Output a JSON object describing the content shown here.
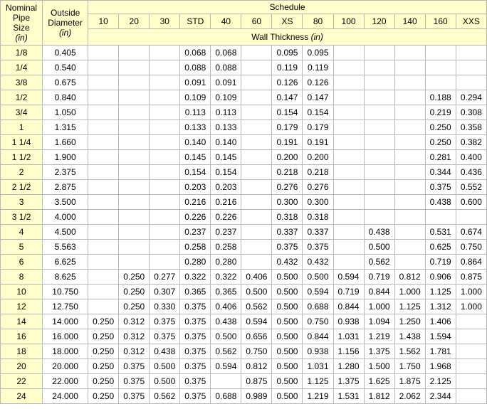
{
  "header": {
    "nominal_lines": [
      "Nominal",
      "Pipe",
      "Size"
    ],
    "nominal_unit": "(in)",
    "outside_lines": [
      "Outside",
      "Diameter"
    ],
    "outside_unit": "(in)",
    "schedule_title": "Schedule",
    "wall_label": "Wall Thickness",
    "wall_unit": "(in)"
  },
  "schedules": [
    "10",
    "20",
    "30",
    "STD",
    "40",
    "60",
    "XS",
    "80",
    "100",
    "120",
    "140",
    "160",
    "XXS"
  ],
  "rows": [
    {
      "nps": "1/8",
      "od": "0.405",
      "t": [
        "",
        "",
        "",
        "0.068",
        "0.068",
        "",
        "0.095",
        "0.095",
        "",
        "",
        "",
        "",
        ""
      ]
    },
    {
      "nps": "1/4",
      "od": "0.540",
      "t": [
        "",
        "",
        "",
        "0.088",
        "0.088",
        "",
        "0.119",
        "0.119",
        "",
        "",
        "",
        "",
        ""
      ]
    },
    {
      "nps": "3/8",
      "od": "0.675",
      "t": [
        "",
        "",
        "",
        "0.091",
        "0.091",
        "",
        "0.126",
        "0.126",
        "",
        "",
        "",
        "",
        ""
      ]
    },
    {
      "nps": "1/2",
      "od": "0.840",
      "t": [
        "",
        "",
        "",
        "0.109",
        "0.109",
        "",
        "0.147",
        "0.147",
        "",
        "",
        "",
        "0.188",
        "0.294"
      ]
    },
    {
      "nps": "3/4",
      "od": "1.050",
      "t": [
        "",
        "",
        "",
        "0.113",
        "0.113",
        "",
        "0.154",
        "0.154",
        "",
        "",
        "",
        "0.219",
        "0.308"
      ]
    },
    {
      "nps": "1",
      "od": "1.315",
      "t": [
        "",
        "",
        "",
        "0.133",
        "0.133",
        "",
        "0.179",
        "0.179",
        "",
        "",
        "",
        "0.250",
        "0.358"
      ]
    },
    {
      "nps": "1 1/4",
      "od": "1.660",
      "t": [
        "",
        "",
        "",
        "0.140",
        "0.140",
        "",
        "0.191",
        "0.191",
        "",
        "",
        "",
        "0.250",
        "0.382"
      ]
    },
    {
      "nps": "1 1/2",
      "od": "1.900",
      "t": [
        "",
        "",
        "",
        "0.145",
        "0.145",
        "",
        "0.200",
        "0.200",
        "",
        "",
        "",
        "0.281",
        "0.400"
      ]
    },
    {
      "nps": "2",
      "od": "2.375",
      "t": [
        "",
        "",
        "",
        "0.154",
        "0.154",
        "",
        "0.218",
        "0.218",
        "",
        "",
        "",
        "0.344",
        "0.436"
      ]
    },
    {
      "nps": "2 1/2",
      "od": "2.875",
      "t": [
        "",
        "",
        "",
        "0.203",
        "0.203",
        "",
        "0.276",
        "0.276",
        "",
        "",
        "",
        "0.375",
        "0.552"
      ]
    },
    {
      "nps": "3",
      "od": "3.500",
      "t": [
        "",
        "",
        "",
        "0.216",
        "0.216",
        "",
        "0.300",
        "0.300",
        "",
        "",
        "",
        "0.438",
        "0.600"
      ]
    },
    {
      "nps": "3 1/2",
      "od": "4.000",
      "t": [
        "",
        "",
        "",
        "0.226",
        "0.226",
        "",
        "0.318",
        "0.318",
        "",
        "",
        "",
        "",
        ""
      ]
    },
    {
      "nps": "4",
      "od": "4.500",
      "t": [
        "",
        "",
        "",
        "0.237",
        "0.237",
        "",
        "0.337",
        "0.337",
        "",
        "0.438",
        "",
        "0.531",
        "0.674"
      ]
    },
    {
      "nps": "5",
      "od": "5.563",
      "t": [
        "",
        "",
        "",
        "0.258",
        "0.258",
        "",
        "0.375",
        "0.375",
        "",
        "0.500",
        "",
        "0.625",
        "0.750"
      ]
    },
    {
      "nps": "6",
      "od": "6.625",
      "t": [
        "",
        "",
        "",
        "0.280",
        "0.280",
        "",
        "0.432",
        "0.432",
        "",
        "0.562",
        "",
        "0.719",
        "0.864"
      ]
    },
    {
      "nps": "8",
      "od": "8.625",
      "t": [
        "",
        "0.250",
        "0.277",
        "0.322",
        "0.322",
        "0.406",
        "0.500",
        "0.500",
        "0.594",
        "0.719",
        "0.812",
        "0.906",
        "0.875"
      ]
    },
    {
      "nps": "10",
      "od": "10.750",
      "t": [
        "",
        "0.250",
        "0.307",
        "0.365",
        "0.365",
        "0.500",
        "0.500",
        "0.594",
        "0.719",
        "0.844",
        "1.000",
        "1.125",
        "1.000"
      ]
    },
    {
      "nps": "12",
      "od": "12.750",
      "t": [
        "",
        "0.250",
        "0.330",
        "0.375",
        "0.406",
        "0.562",
        "0.500",
        "0.688",
        "0.844",
        "1.000",
        "1.125",
        "1.312",
        "1.000"
      ]
    },
    {
      "nps": "14",
      "od": "14.000",
      "t": [
        "0.250",
        "0.312",
        "0.375",
        "0.375",
        "0.438",
        "0.594",
        "0.500",
        "0.750",
        "0.938",
        "1.094",
        "1.250",
        "1.406",
        ""
      ]
    },
    {
      "nps": "16",
      "od": "16.000",
      "t": [
        "0.250",
        "0.312",
        "0.375",
        "0.375",
        "0.500",
        "0.656",
        "0.500",
        "0.844",
        "1.031",
        "1.219",
        "1.438",
        "1.594",
        ""
      ]
    },
    {
      "nps": "18",
      "od": "18.000",
      "t": [
        "0.250",
        "0.312",
        "0.438",
        "0.375",
        "0.562",
        "0.750",
        "0.500",
        "0.938",
        "1.156",
        "1.375",
        "1.562",
        "1.781",
        ""
      ]
    },
    {
      "nps": "20",
      "od": "20.000",
      "t": [
        "0.250",
        "0.375",
        "0.500",
        "0.375",
        "0.594",
        "0.812",
        "0.500",
        "1.031",
        "1.280",
        "1.500",
        "1.750",
        "1.968",
        ""
      ]
    },
    {
      "nps": "22",
      "od": "22.000",
      "t": [
        "0.250",
        "0.375",
        "0.500",
        "0.375",
        "",
        "0.875",
        "0.500",
        "1.125",
        "1.375",
        "1.625",
        "1.875",
        "2.125",
        ""
      ]
    },
    {
      "nps": "24",
      "od": "24.000",
      "t": [
        "0.250",
        "0.375",
        "0.562",
        "0.375",
        "0.688",
        "0.989",
        "0.500",
        "1.219",
        "1.531",
        "1.812",
        "2.062",
        "2.344",
        ""
      ]
    }
  ]
}
